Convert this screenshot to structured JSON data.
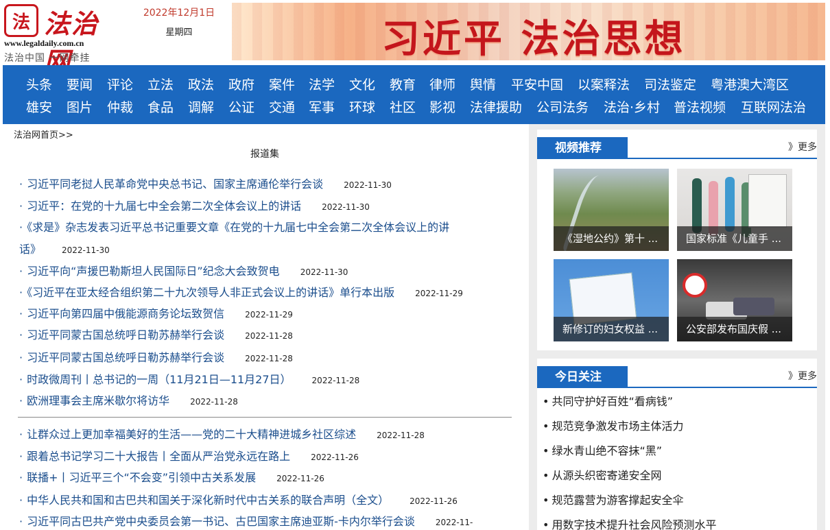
{
  "header": {
    "logo_seal": "法",
    "logo_name": "法治网",
    "logo_url": "www.legaldaily.com.cn",
    "logo_slogan": "法治中国  一网牵挂",
    "date": "2022年12月1日",
    "weekday": "星期四",
    "banner_text": "习近平 法治思想"
  },
  "nav": {
    "row1": [
      "头条",
      "要闻",
      "评论",
      "立法",
      "政法",
      "政府",
      "案件",
      "法学",
      "文化",
      "教育",
      "律师",
      "舆情",
      "平安中国",
      "以案释法",
      "司法鉴定",
      "粤港澳大湾区"
    ],
    "row2": [
      "雄安",
      "图片",
      "仲裁",
      "食品",
      "调解",
      "公证",
      "交通",
      "军事",
      "环球",
      "社区",
      "影视",
      "法律援助",
      "公司法务",
      "法治·乡村",
      "普法视频",
      "互联网法治"
    ]
  },
  "breadcrumb": "法治网首页>>",
  "section_title": "报道集",
  "news": [
    {
      "title": "习近平同老挝人民革命党中央总书记、国家主席通伦举行会谈",
      "date": "2022-11-30"
    },
    {
      "title": "习近平：在党的十九届七中全会第二次全体会议上的讲话",
      "date": "2022-11-30"
    },
    {
      "title": "《求是》杂志发表习近平总书记重要文章《在党的十九届七中全会第二次全体会议上的讲",
      "title_cont": "话》",
      "date": "2022-11-30"
    },
    {
      "title": "习近平向“声援巴勒斯坦人民国际日”纪念大会致贺电",
      "date": "2022-11-30"
    },
    {
      "title": "《习近平在亚太经合组织第二十九次领导人非正式会议上的讲话》单行本出版",
      "date": "2022-11-29"
    },
    {
      "title": "习近平向第四届中俄能源商务论坛致贺信",
      "date": "2022-11-29"
    },
    {
      "title": "习近平同蒙古国总统呼日勒苏赫举行会谈",
      "date": "2022-11-28"
    },
    {
      "title": "习近平同蒙古国总统呼日勒苏赫举行会谈",
      "date": "2022-11-28"
    },
    {
      "title": "时政微周刊丨总书记的一周（11月21日—11月27日）",
      "date": "2022-11-28"
    },
    {
      "title": "欧洲理事会主席米歇尔将访华",
      "date": "2022-11-28"
    }
  ],
  "news2": [
    {
      "title": "让群众过上更加幸福美好的生活——党的二十大精神进城乡社区综述",
      "date": "2022-11-28"
    },
    {
      "title": "跟着总书记学习二十大报告丨全面从严治党永远在路上",
      "date": "2022-11-26"
    },
    {
      "title": "联播+丨习近平三个“不会变”引领中古关系发展",
      "date": "2022-11-26"
    },
    {
      "title": "中华人民共和国和古巴共和国关于深化新时代中古关系的联合声明（全文）",
      "date": "2022-11-26"
    },
    {
      "title": "习近平同古巴共产党中央委员会第一书记、古巴国家主席迪亚斯-卡内尔举行会谈",
      "date": "2022-11-"
    }
  ],
  "video": {
    "title": "视频推荐",
    "more": "》更多",
    "items": [
      {
        "caption": "《湿地公约》第十 ..."
      },
      {
        "caption": "国家标准《儿童手 ..."
      },
      {
        "caption": "新修订的妇女权益 ..."
      },
      {
        "caption": "公安部发布国庆假 ..."
      }
    ]
  },
  "focus": {
    "title": "今日关注",
    "more": "》更多",
    "items": [
      "共同守护好百姓“看病钱”",
      "规范竞争激发市场主体活力",
      "绿水青山绝不容抹“黑”",
      "从源头织密寄递安全网",
      "规范露营为游客撑起安全伞",
      "用数字技术提升社会风险预测水平"
    ]
  }
}
